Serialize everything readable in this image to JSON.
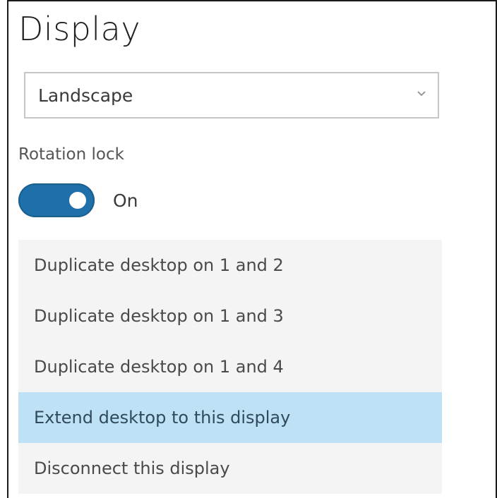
{
  "display": {
    "title": "Display"
  },
  "orientation": {
    "selected": "Landscape",
    "chevron_icon": "chevron-down-icon"
  },
  "rotation_lock": {
    "label": "Rotation lock",
    "state_text": "On"
  },
  "menu": {
    "items": [
      "Duplicate desktop on 1 and 2",
      "Duplicate desktop on 1 and 3",
      "Duplicate desktop on 1 and 4",
      "Extend desktop to this display",
      "Disconnect this display"
    ],
    "selected_index": 3
  },
  "colors": {
    "accent": "#1f6fa8",
    "selection": "#bfe1f5"
  }
}
